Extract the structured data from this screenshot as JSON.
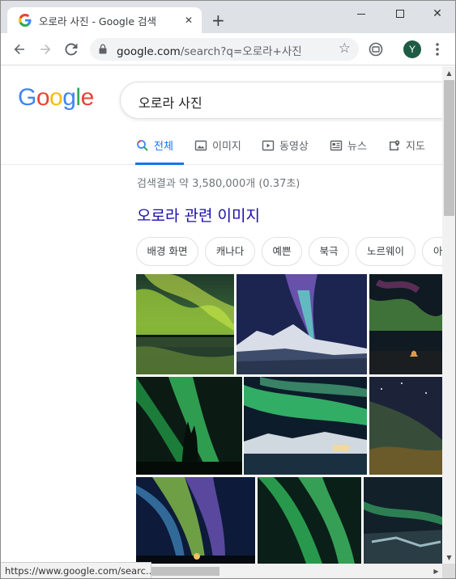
{
  "window": {
    "tab_title": "오로라 사진 - Google 검색",
    "new_tab_symbol": "+",
    "close_symbol": "✕"
  },
  "toolbar": {
    "url_host": "google.com",
    "url_path": "/search?q=오로라+사진",
    "profile_initial": "Y"
  },
  "logo": {
    "letters": [
      "G",
      "o",
      "o",
      "g",
      "l",
      "e"
    ],
    "colors": [
      "#4285f4",
      "#ea4335",
      "#fbbc05",
      "#4285f4",
      "#34a853",
      "#ea4335"
    ]
  },
  "search": {
    "query": "오로라 사진"
  },
  "nav_tabs": [
    {
      "label": "전체",
      "icon": "search-icon",
      "active": true
    },
    {
      "label": "이미지",
      "icon": "image-icon",
      "active": false
    },
    {
      "label": "동영상",
      "icon": "video-icon",
      "active": false
    },
    {
      "label": "뉴스",
      "icon": "news-icon",
      "active": false
    },
    {
      "label": "지도",
      "icon": "map-icon",
      "active": false
    }
  ],
  "result_stats": "검색결과 약 3,580,000개 (0.37초)",
  "related_images_title": "오로라 관련 이미지",
  "chips": [
    "배경 화면",
    "캐나다",
    "예쁜",
    "북극",
    "노르웨이",
    "아"
  ],
  "status_url": "https://www.google.com/searc...",
  "colors": {
    "accent": "#1a73e8",
    "link": "#1a0dab",
    "titlebar": "#dee1e6",
    "profile": "#1e5b45"
  }
}
